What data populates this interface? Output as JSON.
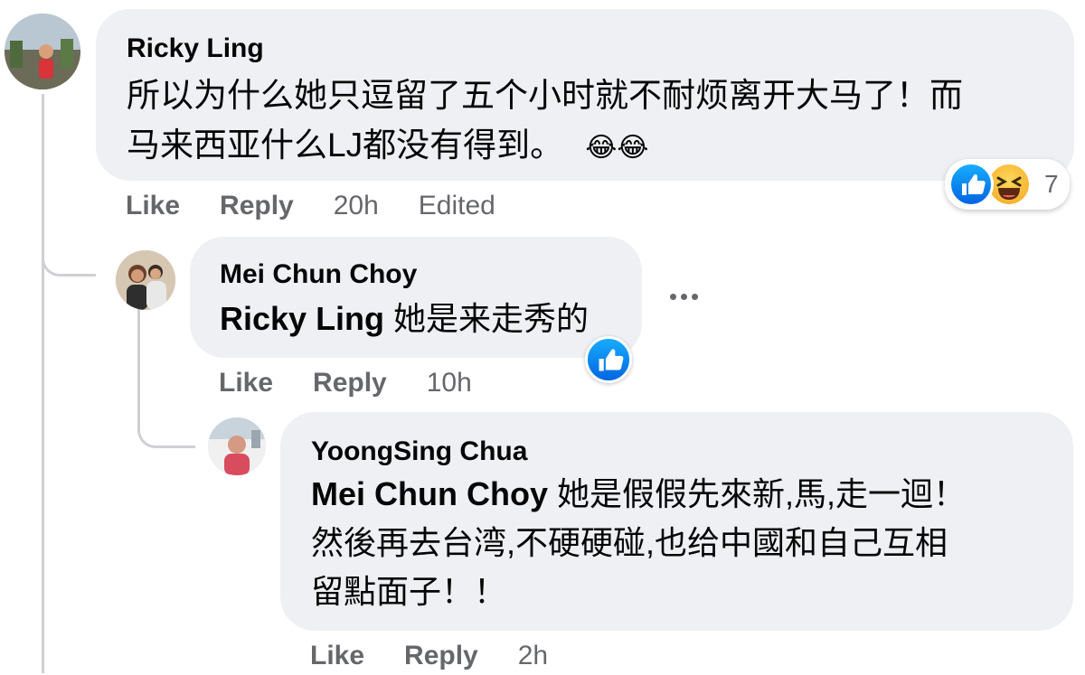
{
  "comments": [
    {
      "author": "Ricky Ling",
      "text_line1": "所以为什么她只逗留了五个小时就不耐烦离开大马了！而",
      "text_line2": "马来西亚什么LJ都没有得到。",
      "emoji": "😂😂",
      "like_label": "Like",
      "reply_label": "Reply",
      "time": "20h",
      "edited": "Edited",
      "reaction_count": "7",
      "reactions": [
        "like-icon",
        "haha-icon"
      ]
    },
    {
      "author": "Mei Chun Choy",
      "mention": "Ricky Ling",
      "text": " 她是来走秀的",
      "like_label": "Like",
      "reply_label": "Reply",
      "time": "10h",
      "reactions": [
        "like-icon"
      ]
    },
    {
      "author": "YoongSing Chua",
      "mention": "Mei Chun Choy",
      "text_line1": " 她是假假先來新,馬,走一迴！",
      "text_line2": "然後再去台湾,不硬硬碰,也给中國和自己互相",
      "text_line3": "留點面子！！",
      "like_label": "Like",
      "reply_label": "Reply",
      "time": "2h"
    }
  ],
  "colors": {
    "bubble": "#eef0f3",
    "meta_text": "#65676b",
    "thread_line": "#ced0d4",
    "like_blue": "#0866ff"
  }
}
